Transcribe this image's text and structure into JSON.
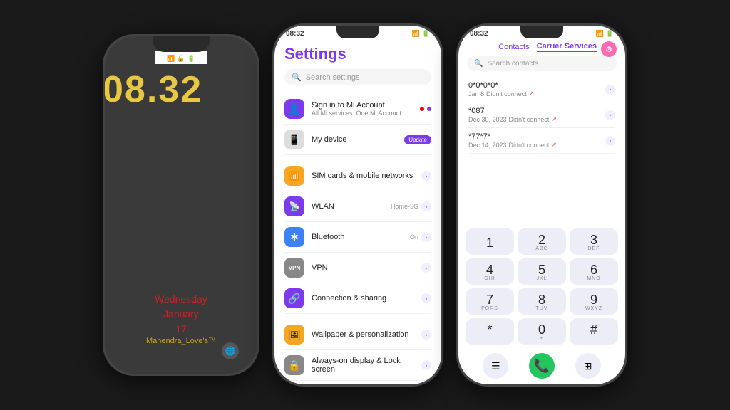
{
  "phone1": {
    "time": "08.32",
    "date": "Wednesday\nJanuary\n17",
    "username": "Mahendra_Love's™",
    "statusIcons": "📶🔒🔋"
  },
  "phone2": {
    "statusTime": "08:32",
    "title": "Settings",
    "search": {
      "placeholder": "Search settings"
    },
    "items": [
      {
        "icon": "👤",
        "iconBg": "#7c3aed",
        "title": "Sign in to Mi Account",
        "sub": "All Mi services. One Mi Account.",
        "rightType": "dots"
      },
      {
        "icon": "📱",
        "iconBg": "#888",
        "title": "My device",
        "sub": "",
        "rightType": "update"
      },
      {
        "icon": "📶",
        "iconBg": "#f5a623",
        "title": "SIM cards & mobile networks",
        "sub": "",
        "rightType": "chevron"
      },
      {
        "icon": "📡",
        "iconBg": "#7c3aed",
        "title": "WLAN",
        "sub": "",
        "value": "Home-5G",
        "rightType": "chevron"
      },
      {
        "icon": "✱",
        "iconBg": "#3b82f6",
        "title": "Bluetooth",
        "sub": "",
        "value": "On",
        "rightType": "chevron"
      },
      {
        "icon": "VPN",
        "iconBg": "#888",
        "title": "VPN",
        "sub": "",
        "rightType": "chevron"
      },
      {
        "icon": "🔗",
        "iconBg": "#7c3aed",
        "title": "Connection & sharing",
        "sub": "",
        "rightType": "chevron"
      },
      {
        "icon": "🖼",
        "iconBg": "#f5a623",
        "title": "Wallpaper & personalization",
        "sub": "",
        "rightType": "chevron"
      },
      {
        "icon": "🔒",
        "iconBg": "#888",
        "title": "Always-on display & Lock screen",
        "sub": "",
        "rightType": "chevron"
      }
    ]
  },
  "phone3": {
    "statusTime": "08:32",
    "tabs": [
      "Contacts",
      "Carrier Services"
    ],
    "search": {
      "placeholder": "Search contacts"
    },
    "calls": [
      {
        "number": "0*0*0*0*",
        "date": "Jan 8",
        "status": "Didn't connect"
      },
      {
        "number": "*087",
        "date": "Dec 30, 2023",
        "status": "Didn't connect"
      },
      {
        "number": "*77*7*",
        "date": "Dec 14, 2023",
        "status": "Didn't connect"
      }
    ],
    "numpad": [
      {
        "num": "1",
        "letters": ""
      },
      {
        "num": "2",
        "letters": "ABC"
      },
      {
        "num": "3",
        "letters": "DEF"
      },
      {
        "num": "4",
        "letters": "GHI"
      },
      {
        "num": "5",
        "letters": "JKL"
      },
      {
        "num": "6",
        "letters": "MNO"
      },
      {
        "num": "7",
        "letters": "PQRS"
      },
      {
        "num": "8",
        "letters": "TUV"
      },
      {
        "num": "9",
        "letters": "WXYZ"
      },
      {
        "num": "*",
        "letters": ""
      },
      {
        "num": "0",
        "letters": "+"
      },
      {
        "num": "#",
        "letters": ""
      }
    ],
    "actions": [
      "menu",
      "call",
      "dialpad"
    ]
  }
}
